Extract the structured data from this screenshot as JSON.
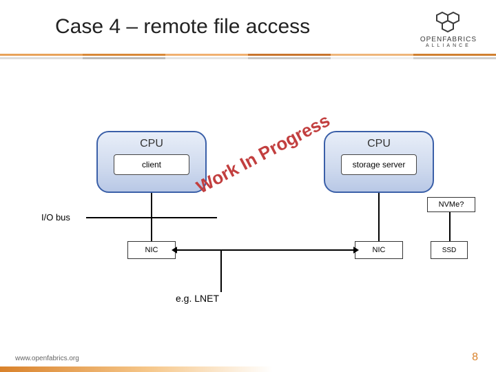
{
  "title": "Case 4 – remote file access",
  "logo": {
    "name": "OPENFABRICS",
    "sub": "ALLIANCE"
  },
  "diagram": {
    "left_cpu": {
      "label": "CPU",
      "box": "client"
    },
    "right_cpu": {
      "label": "CPU",
      "box": "storage server"
    },
    "iobus": "I/O bus",
    "nic_left": "NIC",
    "nic_right": "NIC",
    "ssd": "SSD",
    "nvme": "NVMe?",
    "net_label": "e.g. LNET",
    "overlay": "Work In Progress"
  },
  "footer": {
    "url": "www.openfabrics.org",
    "page": "8"
  },
  "colors": {
    "accent_orange": "#d9822b",
    "cpu_border": "#3a5fa8",
    "overlay_red": "#c23f3f"
  }
}
